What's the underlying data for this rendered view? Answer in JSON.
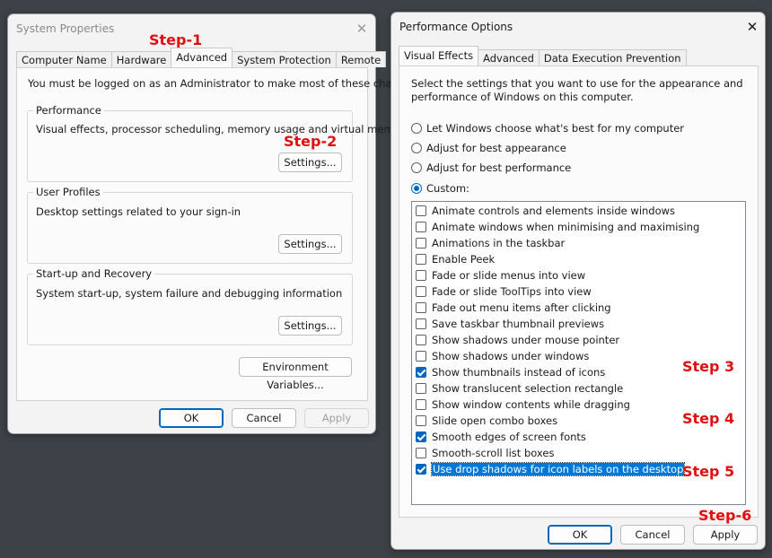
{
  "system_properties": {
    "title": "System Properties",
    "tabs": [
      "Computer Name",
      "Hardware",
      "Advanced",
      "System Protection",
      "Remote"
    ],
    "admin_note": "You must be logged on as an Administrator to make most of these changes.",
    "performance": {
      "title": "Performance",
      "description": "Visual effects, processor scheduling, memory usage and virtual memory",
      "button": "Settings..."
    },
    "user_profiles": {
      "title": "User Profiles",
      "description": "Desktop settings related to your sign-in",
      "button": "Settings..."
    },
    "startup_recovery": {
      "title": "Start-up and Recovery",
      "description": "System start-up, system failure and debugging information",
      "button": "Settings..."
    },
    "env_button": "Environment Variables...",
    "ok": "OK",
    "cancel": "Cancel",
    "apply": "Apply"
  },
  "performance_options": {
    "title": "Performance Options",
    "tabs": [
      "Visual Effects",
      "Advanced",
      "Data Execution Prevention"
    ],
    "intro_line1": "Select the settings that you want to use for the appearance and",
    "intro_line2": "performance of Windows on this computer.",
    "radios": [
      {
        "label": "Let Windows choose what's best for my computer",
        "checked": false
      },
      {
        "label": "Adjust for best appearance",
        "checked": false
      },
      {
        "label": "Adjust for best performance",
        "checked": false
      },
      {
        "label": "Custom:",
        "checked": true
      }
    ],
    "effects": [
      {
        "label": "Animate controls and elements inside windows",
        "checked": false
      },
      {
        "label": "Animate windows when minimising and maximising",
        "checked": false
      },
      {
        "label": "Animations in the taskbar",
        "checked": false
      },
      {
        "label": "Enable Peek",
        "checked": false
      },
      {
        "label": "Fade or slide menus into view",
        "checked": false
      },
      {
        "label": "Fade or slide ToolTips into view",
        "checked": false
      },
      {
        "label": "Fade out menu items after clicking",
        "checked": false
      },
      {
        "label": "Save taskbar thumbnail previews",
        "checked": false
      },
      {
        "label": "Show shadows under mouse pointer",
        "checked": false
      },
      {
        "label": "Show shadows under windows",
        "checked": false
      },
      {
        "label": "Show thumbnails instead of icons",
        "checked": true
      },
      {
        "label": "Show translucent selection rectangle",
        "checked": false
      },
      {
        "label": "Show window contents while dragging",
        "checked": false
      },
      {
        "label": "Slide open combo boxes",
        "checked": false
      },
      {
        "label": "Smooth edges of screen fonts",
        "checked": true
      },
      {
        "label": "Smooth-scroll list boxes",
        "checked": false
      },
      {
        "label": "Use drop shadows for icon labels on the desktop",
        "checked": true,
        "selected": true
      }
    ],
    "ok": "OK",
    "cancel": "Cancel",
    "apply": "Apply"
  },
  "annotations": {
    "step1": "Step-1",
    "step2": "Step-2",
    "step3": "Step 3",
    "step4": "Step 4",
    "step5": "Step 5",
    "step6": "Step-6",
    "color": "#e01010"
  },
  "colors": {
    "accent": "#0067c0",
    "selection": "#0078d7",
    "background": "#3d4248"
  }
}
